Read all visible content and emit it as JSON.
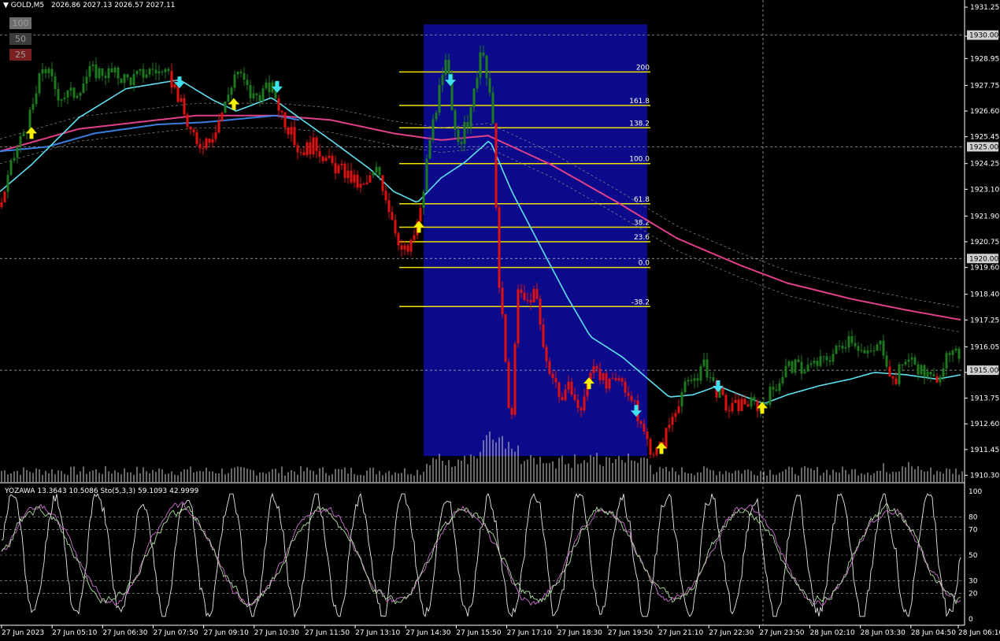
{
  "header": {
    "symbol": "GOLD,M5",
    "quote": "2026.86 2027.13 2026.57 2027.11"
  },
  "buttons": [
    {
      "label": "100",
      "bg": "#6e6e6e"
    },
    {
      "label": "50",
      "bg": "#3c3c3c"
    },
    {
      "label": "25",
      "bg": "#7a2020"
    }
  ],
  "oscillator_label": "YOZAWA 13.3643 10.5086  Sto(5,3,3) 59.1093 42.9999",
  "colors": {
    "bull": "#1f7a1f",
    "bear": "#e01010",
    "ema_fast": "#5fe0f0",
    "ema_mid": "#3a7fe0",
    "ema_slow": "#e0408a",
    "fib": "#f0e000",
    "fib_zone": "#0a0a8a",
    "arrow_up": "#f8f000",
    "arrow_down": "#40e0f0"
  },
  "chart_data": {
    "type": "candlestick",
    "symbol": "GOLD",
    "timeframe": "M5",
    "ylim": [
      1910.0,
      1931.5
    ],
    "y_ticks": [
      "1931.25",
      "1929.95",
      "1928.95",
      "1927.75",
      "1926.60",
      "1925.45",
      "1924.25",
      "1923.10",
      "1921.90",
      "1920.75",
      "1919.60",
      "1918.40",
      "1917.25",
      "1916.05",
      "1914.90",
      "1913.75",
      "1912.60",
      "1911.45",
      "1910.30"
    ],
    "highlighted_levels": [
      "1930.00",
      "1925.00",
      "1920.00",
      "1915.00"
    ],
    "x_ticks": [
      "27 Jun 2023",
      "27 Jun 05:10",
      "27 Jun 06:30",
      "27 Jun 07:50",
      "27 Jun 09:10",
      "27 Jun 10:30",
      "27 Jun 11:50",
      "27 Jun 13:10",
      "27 Jun 14:30",
      "27 Jun 15:50",
      "27 Jun 17:10",
      "27 Jun 18:30",
      "27 Jun 19:50",
      "27 Jun 21:10",
      "27 Jun 22:30",
      "27 Jun 23:50",
      "28 Jun 02:10",
      "28 Jun 03:30",
      "28 Jun 04:50",
      "28 Jun 06:10"
    ],
    "fibonacci": {
      "low": 1919.6,
      "high": 1924.25,
      "levels": [
        {
          "label": "200",
          "value": 1928.35
        },
        {
          "label": "161.8",
          "value": 1926.85
        },
        {
          "label": "138.2",
          "value": 1925.85
        },
        {
          "label": "100.0",
          "value": 1924.25
        },
        {
          "label": "61.8",
          "value": 1922.45
        },
        {
          "label": "38.2",
          "value": 1921.4
        },
        {
          "label": "23.6",
          "value": 1920.75
        },
        {
          "label": "0.0",
          "value": 1919.6
        },
        {
          "label": "-38.2",
          "value": 1917.85
        }
      ]
    },
    "price_path": [
      [
        0,
        1922.3
      ],
      [
        20,
        1924.8
      ],
      [
        40,
        1926.5
      ],
      [
        55,
        1928.7
      ],
      [
        75,
        1927.3
      ],
      [
        95,
        1927.4
      ],
      [
        115,
        1928.4
      ],
      [
        140,
        1928.3
      ],
      [
        165,
        1928.0
      ],
      [
        195,
        1928.5
      ],
      [
        220,
        1927.9
      ],
      [
        235,
        1926.3
      ],
      [
        250,
        1925.0
      ],
      [
        270,
        1925.6
      ],
      [
        285,
        1926.8
      ],
      [
        300,
        1928.5
      ],
      [
        320,
        1927.2
      ],
      [
        345,
        1927.7
      ],
      [
        360,
        1926.3
      ],
      [
        380,
        1924.8
      ],
      [
        400,
        1925.1
      ],
      [
        420,
        1924.2
      ],
      [
        440,
        1923.8
      ],
      [
        460,
        1923.1
      ],
      [
        480,
        1924.0
      ],
      [
        495,
        1922.2
      ],
      [
        510,
        1920.4
      ],
      [
        520,
        1920.3
      ],
      [
        535,
        1922.2
      ],
      [
        545,
        1925.2
      ],
      [
        555,
        1927.0
      ],
      [
        568,
        1928.9
      ],
      [
        575,
        1926.0
      ],
      [
        585,
        1925.3
      ],
      [
        598,
        1926.5
      ],
      [
        610,
        1929.3
      ],
      [
        620,
        1927.9
      ],
      [
        628,
        1925.0
      ],
      [
        633,
        1919.0
      ],
      [
        640,
        1916.5
      ],
      [
        648,
        1912.0
      ],
      [
        658,
        1918.5
      ],
      [
        668,
        1918.0
      ],
      [
        680,
        1918.6
      ],
      [
        690,
        1916.0
      ],
      [
        700,
        1914.9
      ],
      [
        715,
        1913.6
      ],
      [
        725,
        1914.4
      ],
      [
        735,
        1913.0
      ],
      [
        745,
        1914.2
      ],
      [
        755,
        1915.5
      ],
      [
        770,
        1914.2
      ],
      [
        790,
        1914.6
      ],
      [
        805,
        1913.4
      ],
      [
        815,
        1912.4
      ],
      [
        825,
        1911.6
      ],
      [
        832,
        1911.3
      ],
      [
        840,
        1911.6
      ],
      [
        850,
        1912.6
      ],
      [
        865,
        1914.0
      ],
      [
        880,
        1914.6
      ],
      [
        895,
        1915.2
      ],
      [
        910,
        1914.1
      ],
      [
        925,
        1913.2
      ],
      [
        945,
        1913.6
      ],
      [
        965,
        1913.4
      ],
      [
        985,
        1914.3
      ],
      [
        1000,
        1915.2
      ],
      [
        1020,
        1915.1
      ],
      [
        1040,
        1915.3
      ],
      [
        1060,
        1915.8
      ],
      [
        1080,
        1916.6
      ],
      [
        1100,
        1915.6
      ],
      [
        1120,
        1916.2
      ],
      [
        1135,
        1914.4
      ],
      [
        1150,
        1915.6
      ],
      [
        1165,
        1915.2
      ],
      [
        1185,
        1914.5
      ],
      [
        1200,
        1915.4
      ],
      [
        1221,
        1915.8
      ]
    ],
    "ema_fast_path": [
      [
        0,
        1923.0
      ],
      [
        40,
        1924.2
      ],
      [
        100,
        1926.3
      ],
      [
        160,
        1927.6
      ],
      [
        228,
        1928.0
      ],
      [
        270,
        1927.1
      ],
      [
        300,
        1926.6
      ],
      [
        345,
        1927.2
      ],
      [
        380,
        1926.3
      ],
      [
        420,
        1925.3
      ],
      [
        470,
        1924.0
      ],
      [
        500,
        1923.0
      ],
      [
        530,
        1922.5
      ],
      [
        560,
        1923.6
      ],
      [
        590,
        1924.3
      ],
      [
        622,
        1925.3
      ],
      [
        650,
        1923.0
      ],
      [
        690,
        1920.3
      ],
      [
        720,
        1918.3
      ],
      [
        750,
        1916.5
      ],
      [
        790,
        1915.6
      ],
      [
        820,
        1914.7
      ],
      [
        850,
        1913.8
      ],
      [
        880,
        1913.9
      ],
      [
        912,
        1914.3
      ],
      [
        940,
        1913.9
      ],
      [
        970,
        1913.5
      ],
      [
        1000,
        1913.9
      ],
      [
        1040,
        1914.3
      ],
      [
        1080,
        1914.6
      ],
      [
        1110,
        1914.9
      ],
      [
        1150,
        1914.8
      ],
      [
        1190,
        1914.6
      ],
      [
        1221,
        1914.8
      ]
    ],
    "ema_mid_path": [
      [
        0,
        1924.8
      ],
      [
        60,
        1925.0
      ],
      [
        120,
        1925.6
      ],
      [
        200,
        1926.0
      ],
      [
        260,
        1926.1
      ],
      [
        320,
        1926.3
      ],
      [
        350,
        1926.4
      ],
      [
        380,
        1926.2
      ]
    ],
    "ema_slow_path": [
      [
        0,
        1924.8
      ],
      [
        100,
        1925.8
      ],
      [
        250,
        1926.4
      ],
      [
        350,
        1926.4
      ],
      [
        420,
        1926.2
      ],
      [
        500,
        1925.6
      ],
      [
        560,
        1925.3
      ],
      [
        620,
        1925.5
      ],
      [
        700,
        1924.2
      ],
      [
        780,
        1922.6
      ],
      [
        860,
        1920.9
      ],
      [
        940,
        1919.7
      ],
      [
        1000,
        1918.9
      ],
      [
        1080,
        1918.2
      ],
      [
        1150,
        1917.7
      ],
      [
        1221,
        1917.25
      ]
    ],
    "arrows_up": [
      [
        40,
        1925.6
      ],
      [
        297,
        1926.9
      ],
      [
        532,
        1921.4
      ],
      [
        748,
        1914.4
      ],
      [
        840,
        1911.5
      ],
      [
        968,
        1913.3
      ]
    ],
    "arrows_down": [
      [
        228,
        1927.9
      ],
      [
        352,
        1927.7
      ],
      [
        572,
        1928.0
      ],
      [
        912,
        1914.3
      ],
      [
        808,
        1913.2
      ]
    ],
    "oscillator": {
      "label": "YOZAWA / Stochastic(5,3,3)",
      "ylim": [
        0,
        100
      ],
      "y_ticks": [
        "100",
        "80",
        "70",
        "50",
        "30",
        "20",
        "0"
      ],
      "yozawa_last": 13.3643,
      "signal_last": 10.5086,
      "sto_main_last": 59.1093,
      "sto_signal_last": 42.9999
    }
  }
}
